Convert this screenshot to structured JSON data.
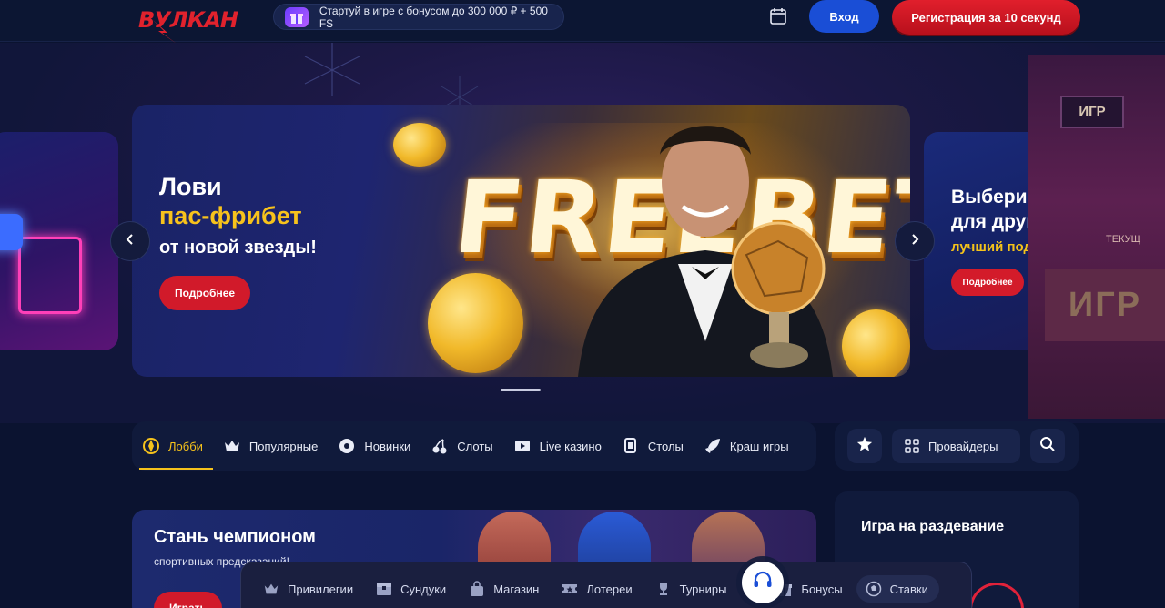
{
  "header": {
    "logo_text": "ВУЛКАН",
    "promo_text": "Стартуй в игре с бонусом до 300 000 ₽ + 500 FS",
    "login_label": "Вход",
    "register_label": "Регистрация за 10 секунд"
  },
  "hero": {
    "main": {
      "line1": "Лови",
      "accent": "пас-фрибет",
      "line3": "от новой звезды!",
      "button": "Подробнее",
      "art_text": "FREEBET"
    },
    "right": {
      "title_line1": "Выбери",
      "title_line2": "для друга",
      "accent": "лучший подарок!",
      "button": "Подробнее"
    },
    "arcade_sign_top": "ИГР",
    "arcade_sign_bottom": "ИГР",
    "arcade_small": "ТЕКУЩ"
  },
  "categories": [
    {
      "label": "Лобби",
      "icon": "lobby-icon",
      "active": true
    },
    {
      "label": "Популярные",
      "icon": "crown-icon",
      "active": false
    },
    {
      "label": "Новинки",
      "icon": "new-badge-icon",
      "active": false
    },
    {
      "label": "Слоты",
      "icon": "cherry-icon",
      "active": false
    },
    {
      "label": "Live казино",
      "icon": "live-cards-icon",
      "active": false
    },
    {
      "label": "Столы",
      "icon": "table-cards-icon",
      "active": false
    },
    {
      "label": "Краш игры",
      "icon": "rocket-icon",
      "active": false
    }
  ],
  "tools": {
    "providers_label": "Провайдеры"
  },
  "champion": {
    "title": "Стань чемпионом",
    "subtitle": "спортивных предсказаний!",
    "button": "Играть"
  },
  "side_strip": {
    "title": "Игра на раздевание"
  },
  "bottom_bar": [
    {
      "label": "Привилегии",
      "icon": "crown-icon"
    },
    {
      "label": "Сундуки",
      "icon": "chest-icon"
    },
    {
      "label": "Магазин",
      "icon": "shop-bag-icon"
    },
    {
      "label": "Лотереи",
      "icon": "ticket-icon"
    },
    {
      "label": "Турниры",
      "icon": "trophy-icon"
    },
    {
      "label": "Бонусы",
      "icon": "gift-icon"
    },
    {
      "label": "Ставки",
      "icon": "soccer-ball-icon",
      "active": true
    }
  ],
  "colors": {
    "brand_red": "#e1222d",
    "accent_yellow": "#f5c21c",
    "login_blue": "#1a4ed6",
    "background": "#0b1330"
  }
}
